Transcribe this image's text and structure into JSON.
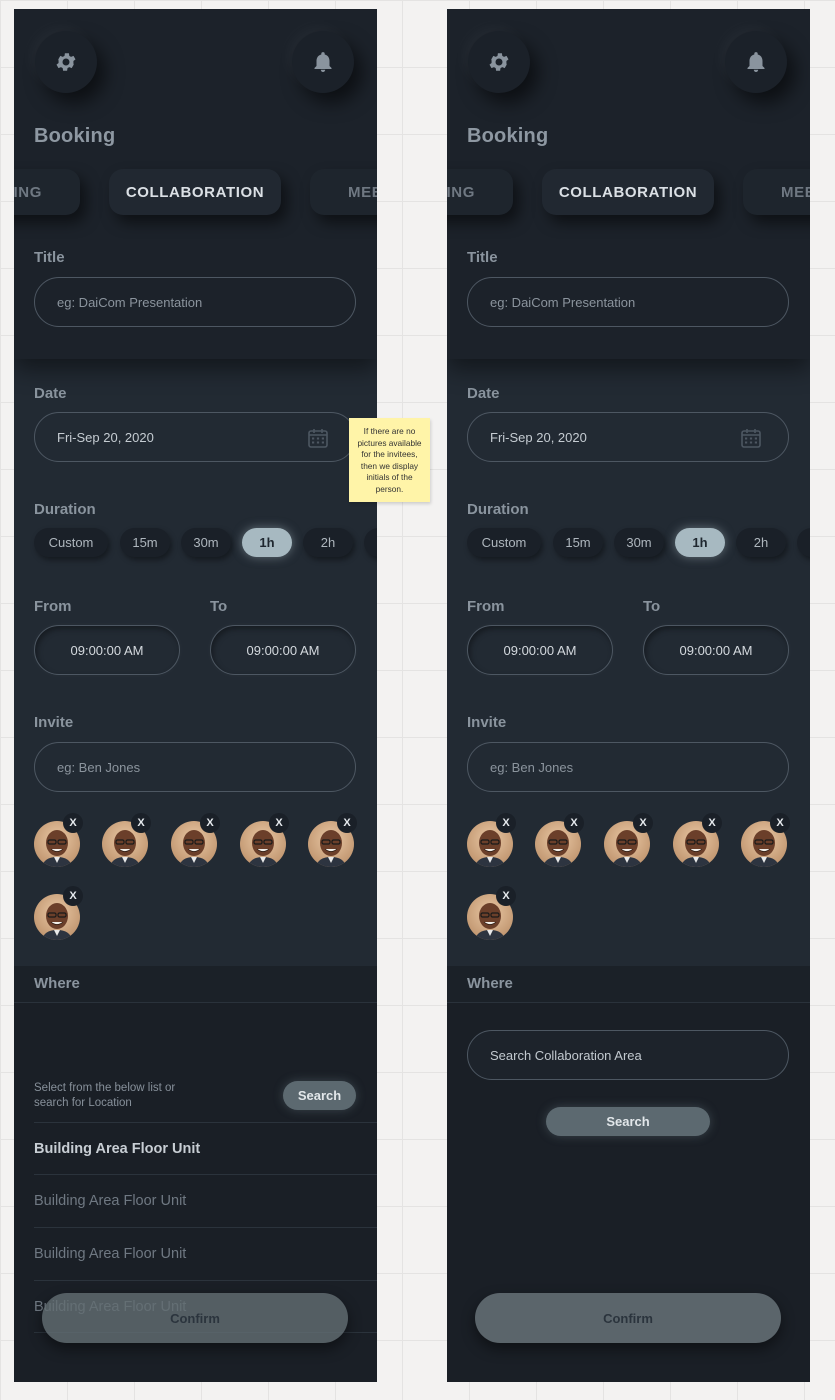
{
  "app": {
    "title": "Booking"
  },
  "tabs": [
    "ING",
    "COLLABORATION",
    "MEE"
  ],
  "title_field": {
    "label": "Title",
    "placeholder": "eg: DaiCom Presentation"
  },
  "date_field": {
    "label": "Date",
    "value": "Fri-Sep 20, 2020",
    "icon": "calendar-icon"
  },
  "duration": {
    "label": "Duration",
    "options": [
      "Custom",
      "15m",
      "30m",
      "1h",
      "2h"
    ],
    "selected": "1h"
  },
  "time": {
    "from_label": "From",
    "from_value": "09:00:00 AM",
    "to_label": "To",
    "to_value": "09:00:00 AM"
  },
  "invite": {
    "label": "Invite",
    "placeholder": "eg: Ben Jones",
    "remove_label": "X",
    "invitee_count": 6
  },
  "where": {
    "label": "Where",
    "hint": "Select from the below list or search for Location",
    "search_button": "Search",
    "search_placeholder": "Search Collaboration Area",
    "locations": [
      "Building Area Floor Unit",
      "Building Area Floor Unit",
      "Building Area Floor Unit",
      "Building Area Floor Unit"
    ]
  },
  "confirm_button": "Confirm",
  "sticky_note": "If there are no pictures available for the invitees, then we display initials of the person.",
  "colors": {
    "background": "#222a33",
    "header": "#1c222a",
    "accent": "#a7b9c1",
    "button": "#5c6970",
    "sticky": "#fff4a8"
  }
}
